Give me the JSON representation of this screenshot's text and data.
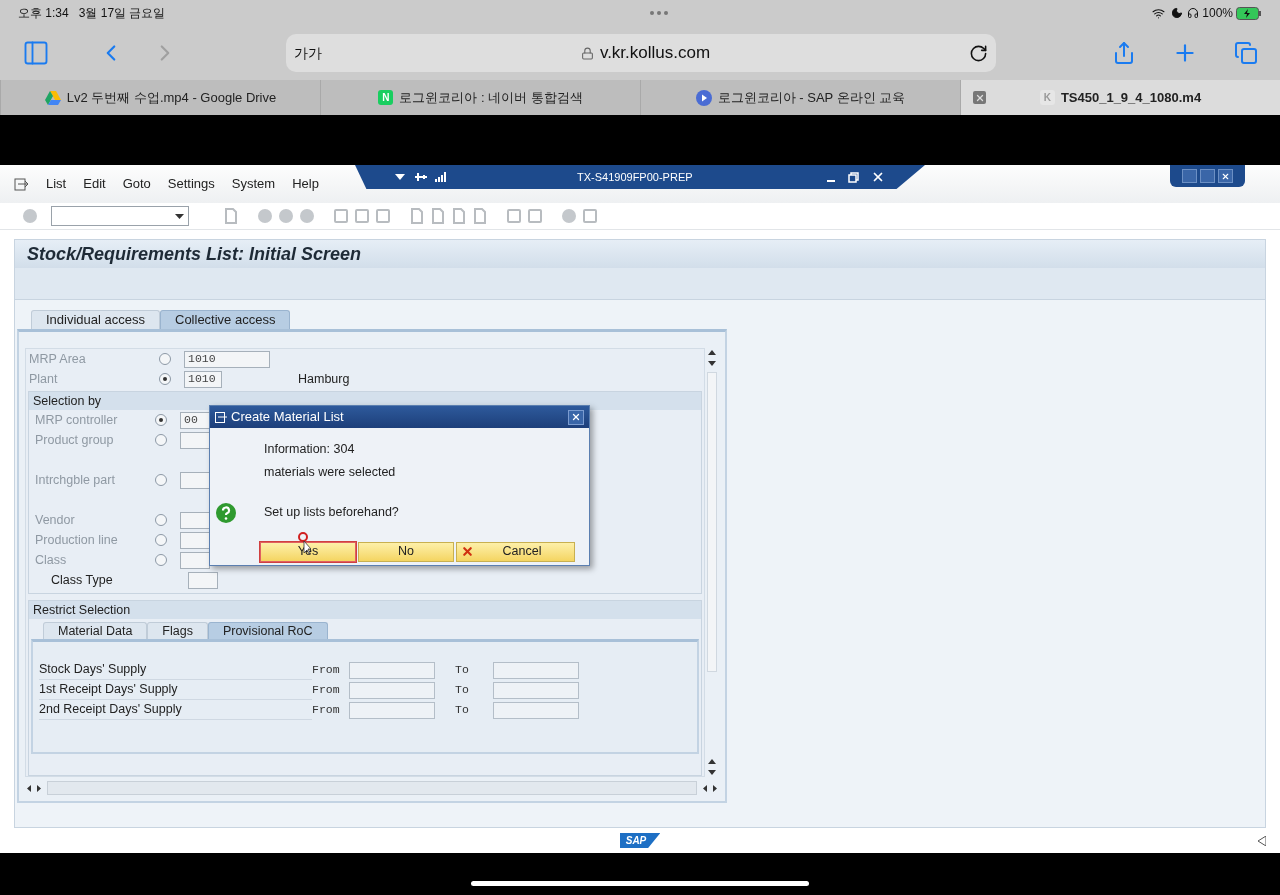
{
  "status_bar": {
    "time": "오후 1:34",
    "date": "3월 17일 금요일",
    "battery": "100%"
  },
  "address_bar": {
    "text_size": "가가",
    "url": "v.kr.kollus.com"
  },
  "browser_tabs": [
    {
      "title": "Lv2 두번째 수업.mp4 - Google Drive",
      "kind": "drive",
      "selected": false
    },
    {
      "title": "로그윈코리아 : 네이버 통합검색",
      "kind": "letter",
      "icon_text": "N",
      "selected": false
    },
    {
      "title": "로그윈코리아 - SAP 온라인 교육",
      "kind": "play",
      "selected": false
    },
    {
      "title": "TS450_1_9_4_1080.m4",
      "kind": "letter",
      "icon_text": "K",
      "selected": true
    }
  ],
  "sap": {
    "menu": [
      "List",
      "Edit",
      "Goto",
      "Settings",
      "System",
      "Help"
    ],
    "session_title": "TX-S41909FP00-PREP",
    "screen_title": "Stock/Requirements List: Initial Screen",
    "tabs": [
      {
        "label": "Individual access",
        "selected": false
      },
      {
        "label": "Collective access",
        "selected": true
      }
    ],
    "top_rows": [
      {
        "label": "MRP Area",
        "selected": false,
        "value": "1010"
      },
      {
        "label": "Plant",
        "selected": true,
        "value": "1010",
        "description": "Hamburg"
      }
    ],
    "selection_by": {
      "title": "Selection by",
      "groups": [
        [
          {
            "kind": "radio",
            "label": "MRP controller",
            "selected": true,
            "value": "00"
          },
          {
            "kind": "radio",
            "label": "Product group",
            "selected": false
          }
        ],
        [
          {
            "kind": "radio",
            "label": "Intrchgble part",
            "selected": false
          }
        ],
        [
          {
            "kind": "radio",
            "label": "Vendor",
            "selected": false
          },
          {
            "kind": "radio",
            "label": "Production line",
            "selected": false
          },
          {
            "kind": "radio",
            "label": "Class",
            "selected": false
          },
          {
            "kind": "plain",
            "label": "Class Type"
          }
        ]
      ]
    },
    "restrict": {
      "title": "Restrict Selection",
      "tabs": [
        {
          "label": "Material Data",
          "selected": false
        },
        {
          "label": "Flags",
          "selected": false
        },
        {
          "label": "Provisional RoC",
          "selected": true
        }
      ],
      "rows": [
        {
          "label": "Stock Days' Supply",
          "from": "From",
          "to": "To"
        },
        {
          "label": "1st Receipt Days' Supply",
          "from": "From",
          "to": "To"
        },
        {
          "label": "2nd Receipt Days' Supply",
          "from": "From",
          "to": "To"
        }
      ]
    },
    "dialog": {
      "title": "Create Material List",
      "lines": [
        "Information: 304",
        "materials were selected"
      ],
      "question": "Set up lists beforehand?",
      "buttons": [
        {
          "label": "Yes",
          "kind": "plain",
          "focused": true
        },
        {
          "label": "No",
          "kind": "plain",
          "focused": false
        },
        {
          "label": "Cancel",
          "kind": "cancel",
          "focused": false
        }
      ]
    },
    "logo": "SAP"
  }
}
